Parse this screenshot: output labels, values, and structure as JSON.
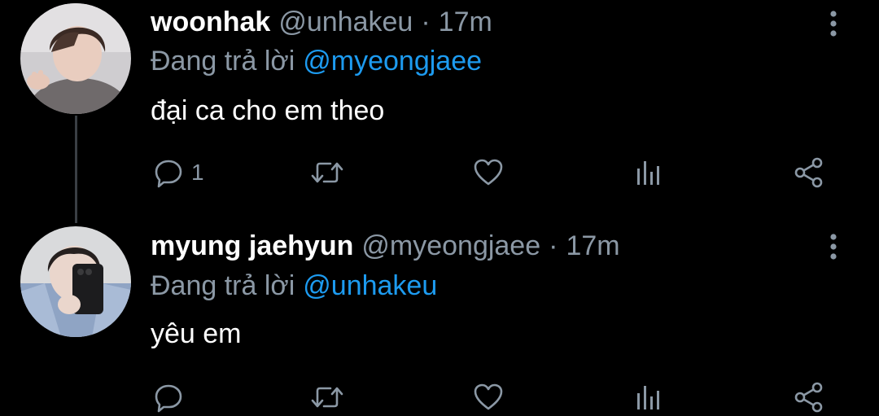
{
  "colors": {
    "background": "#000000",
    "text_primary": "#ffffff",
    "text_secondary": "#8b98a5",
    "mention": "#1d9bf0"
  },
  "tweets": [
    {
      "display_name": "woonhak",
      "handle": "@unhakeu",
      "separator": "·",
      "time": "17m",
      "reply_prefix": "Đang trả lời",
      "reply_to": "@myeongjaee",
      "text": "đại ca cho em theo",
      "reply_count": "1",
      "icons": [
        "reply-icon",
        "retweet-icon",
        "like-icon",
        "views-icon",
        "share-icon",
        "more-icon"
      ]
    },
    {
      "display_name": "myung jaehyun",
      "handle": "@myeongjaee",
      "separator": "·",
      "time": "17m",
      "reply_prefix": "Đang trả lời",
      "reply_to": "@unhakeu",
      "text": "yêu em",
      "reply_count": "",
      "icons": [
        "reply-icon",
        "retweet-icon",
        "like-icon",
        "views-icon",
        "share-icon",
        "more-icon"
      ]
    }
  ]
}
